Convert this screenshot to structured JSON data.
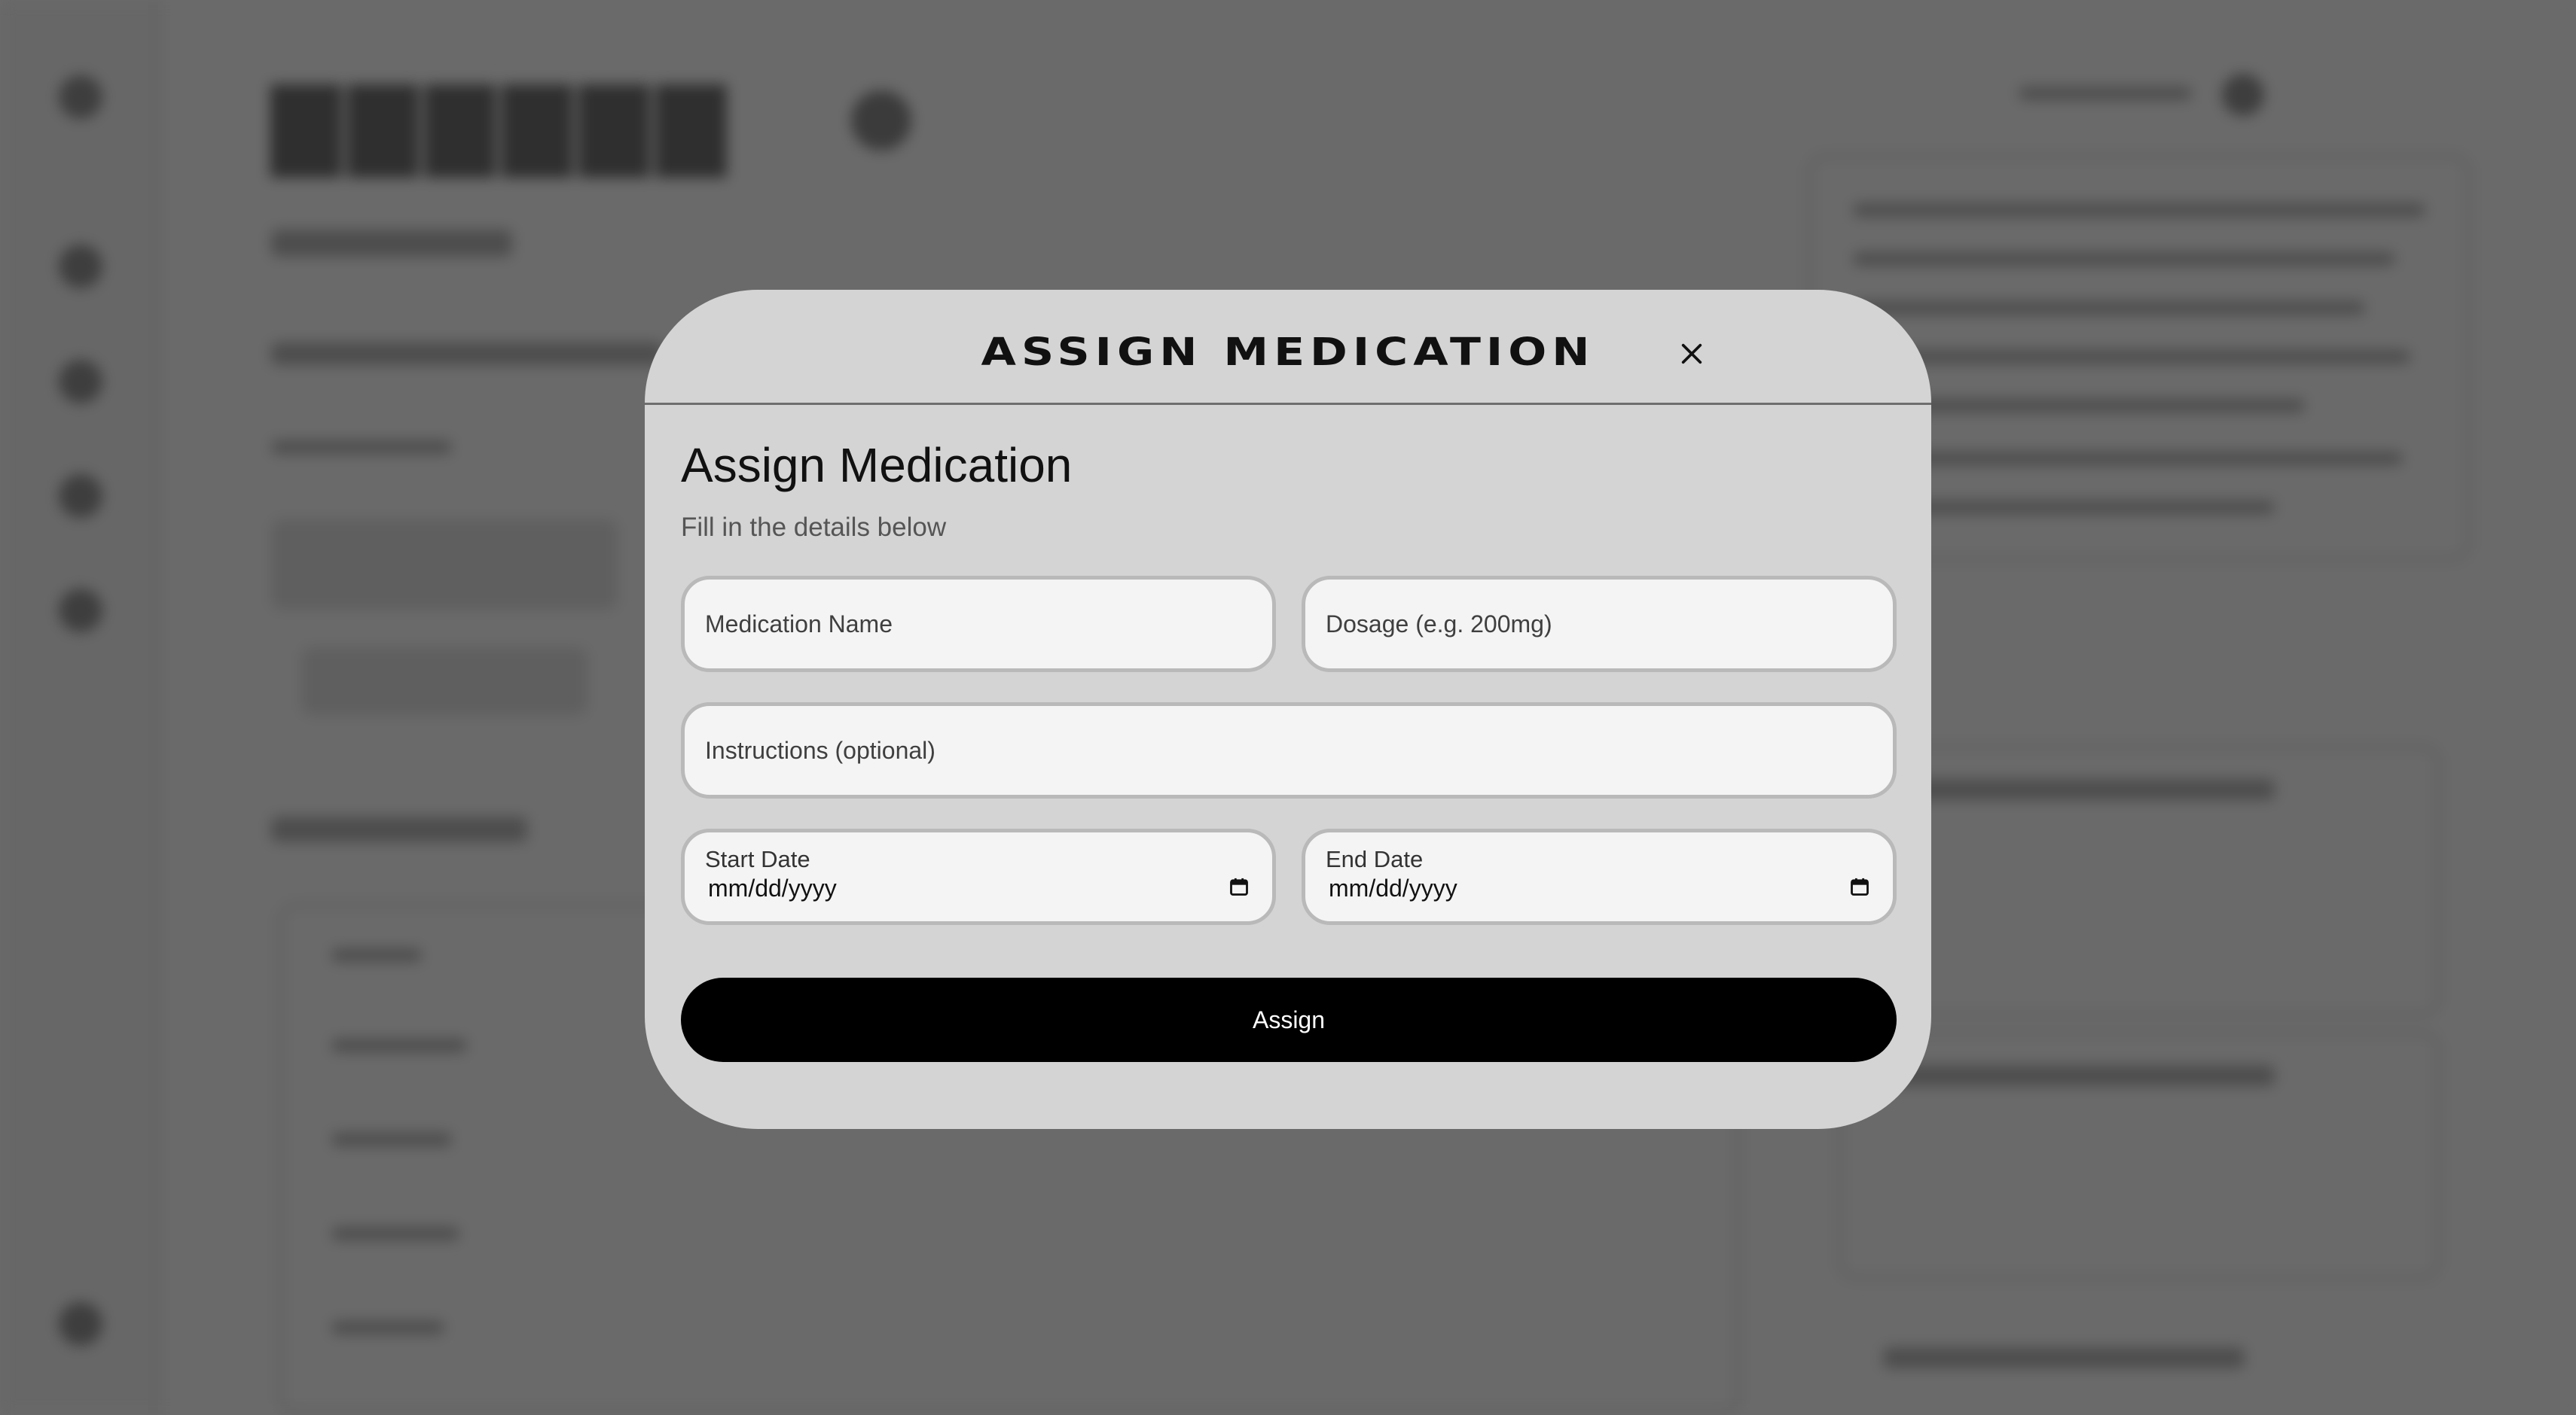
{
  "modal": {
    "brand_title": "ASSIGN MEDICATION",
    "heading": "Assign Medication",
    "subheading": "Fill in the details below",
    "fields": {
      "medication_name": {
        "placeholder": "Medication Name",
        "value": ""
      },
      "dosage": {
        "placeholder": "Dosage (e.g. 200mg)",
        "value": ""
      },
      "instructions": {
        "placeholder": "Instructions (optional)",
        "value": ""
      },
      "start_date": {
        "label": "Start Date",
        "value": "mm/dd/yyyy"
      },
      "end_date": {
        "label": "End Date",
        "value": "mm/dd/yyyy"
      }
    },
    "submit_label": "Assign"
  },
  "icons": {
    "close": "close-icon",
    "calendar": "calendar-icon"
  },
  "colors": {
    "overlay": "#6b6b6b",
    "modal_background": "#d4d4d4",
    "field_background": "#f4f4f4",
    "field_border": "#b9b9b9",
    "primary_button": "#000000",
    "primary_button_text": "#ffffff"
  }
}
